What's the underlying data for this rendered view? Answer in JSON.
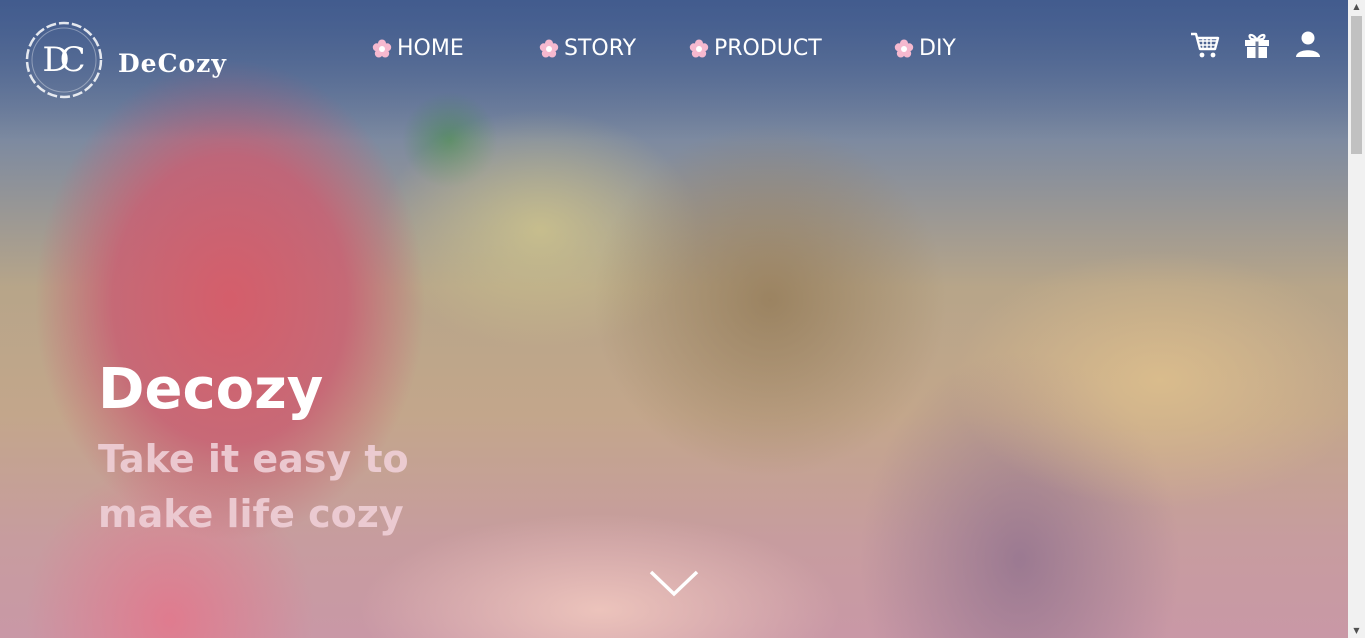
{
  "brand": {
    "monogram": "DC",
    "name": "DeCozy"
  },
  "nav": {
    "items": [
      {
        "label": "HOME",
        "icon": "flower-icon"
      },
      {
        "label": "STORY",
        "icon": "flower-icon"
      },
      {
        "label": "PRODUCT",
        "icon": "flower-icon"
      },
      {
        "label": "DIY",
        "icon": "flower-icon"
      }
    ]
  },
  "header_icons": [
    "cart-icon",
    "gift-icon",
    "user-icon"
  ],
  "hero": {
    "title": "Decozy",
    "subtitle": "Take it easy to make life cozy"
  },
  "colors": {
    "accent_flower": "#f6b9cf",
    "text": "#ffffff",
    "subtitle": "#eeced6"
  }
}
